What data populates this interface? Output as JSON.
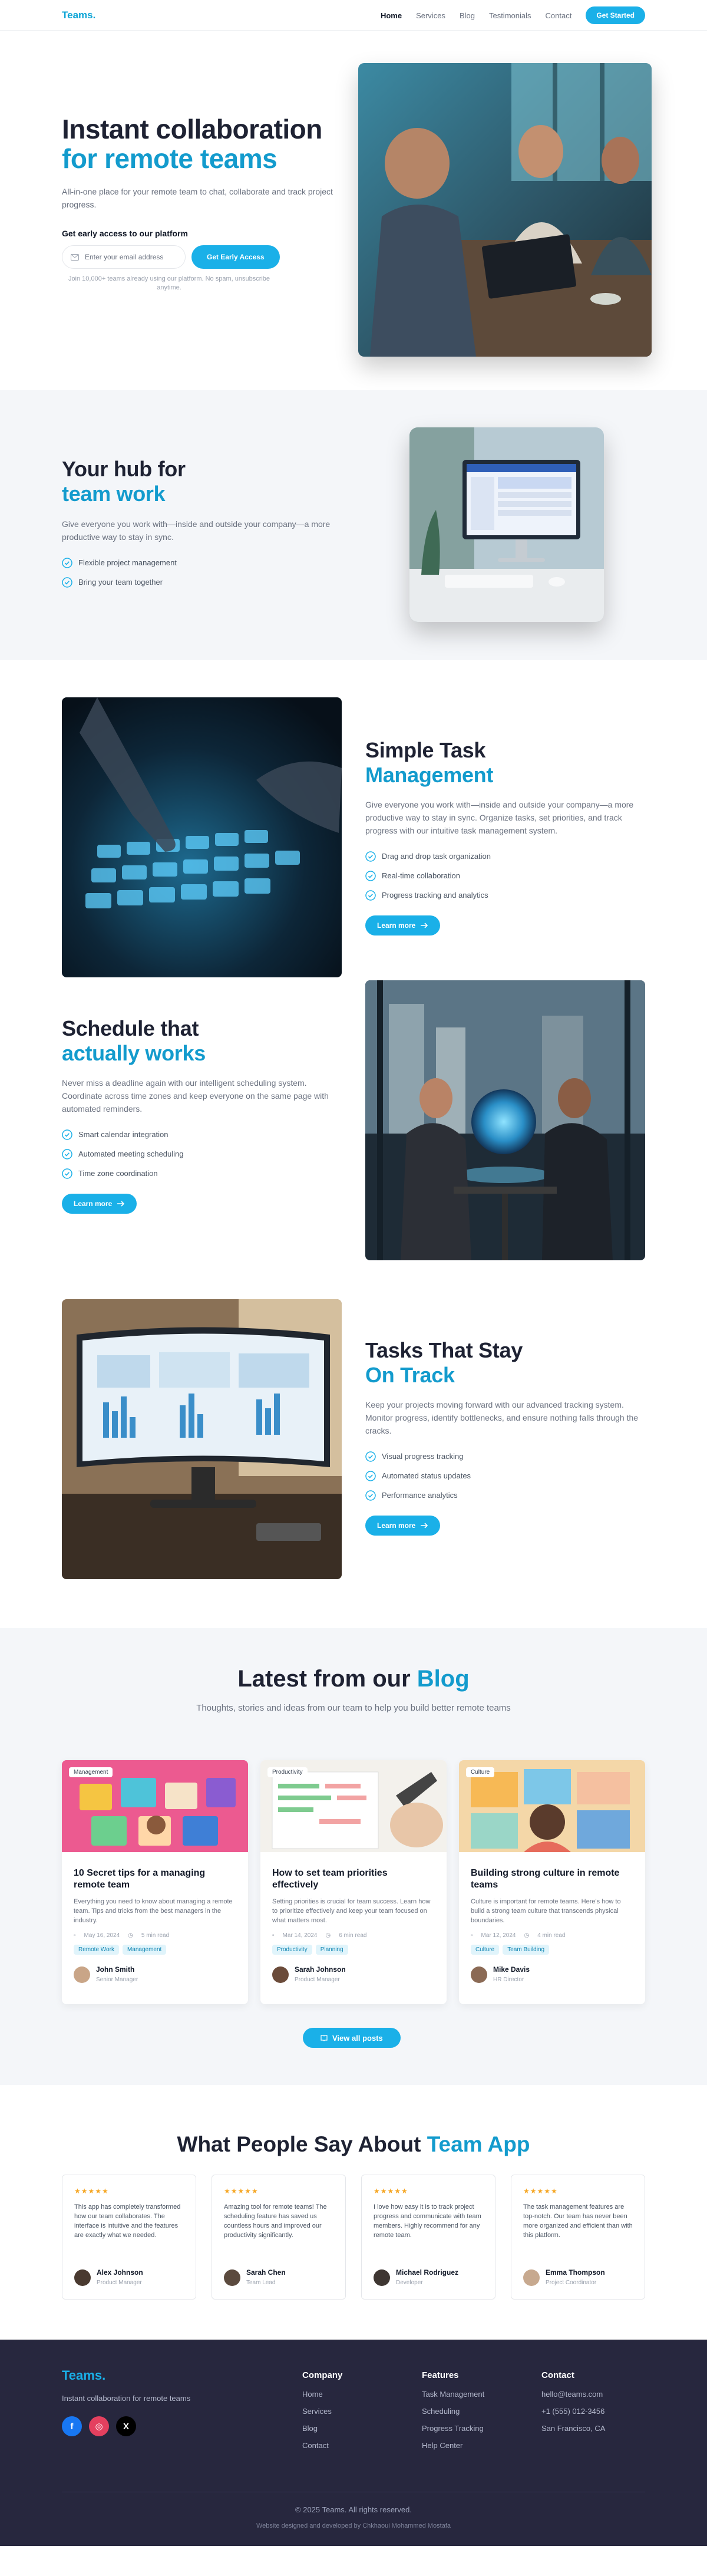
{
  "nav": {
    "logo": "Teams.",
    "links": [
      "Home",
      "Services",
      "Blog",
      "Testimonials",
      "Contact"
    ],
    "cta": "Get Started"
  },
  "hero": {
    "title_line1": "Instant collaboration",
    "title_line2": "for remote teams",
    "subtitle": "All-in-one place for your remote team to chat, collaborate and track project progress.",
    "early_label": "Get early access to our platform",
    "email_placeholder": "Enter your email address",
    "early_button": "Get Early Access",
    "note": "Join 10,000+ teams already using our platform. No spam, unsubscribe anytime."
  },
  "hub": {
    "title_line1": "Your hub for",
    "title_line2": "team work",
    "desc": "Give everyone you work with—inside and outside your company—a more productive way to stay in sync.",
    "features": [
      "Flexible project management",
      "Bring your team together"
    ]
  },
  "task": {
    "title_line1": "Simple Task",
    "title_line2": "Management",
    "desc": "Give everyone you work with—inside and outside your company—a more productive way to stay in sync. Organize tasks, set priorities, and track progress with our intuitive task management system.",
    "features": [
      "Drag and drop task organization",
      "Real-time collaboration",
      "Progress tracking and analytics"
    ],
    "button": "Learn more"
  },
  "schedule": {
    "title_line1": "Schedule that",
    "title_line2": "actually works",
    "desc": "Never miss a deadline again with our intelligent scheduling system. Coordinate across time zones and keep everyone on the same page with automated reminders.",
    "features": [
      "Smart calendar integration",
      "Automated meeting scheduling",
      "Time zone coordination"
    ],
    "button": "Learn more"
  },
  "track": {
    "title_line1": "Tasks That Stay",
    "title_line2": "On Track",
    "desc": "Keep your projects moving forward with our advanced tracking system. Monitor progress, identify bottlenecks, and ensure nothing falls through the cracks.",
    "features": [
      "Visual progress tracking",
      "Automated status updates",
      "Performance analytics"
    ],
    "button": "Learn more"
  },
  "blog": {
    "title_plain": "Latest from our ",
    "title_accent": "Blog",
    "subtitle": "Thoughts, stories and ideas from our team to help you build better remote teams",
    "posts": [
      {
        "badge": "Management",
        "title": "10 Secret tips for a managing remote team",
        "excerpt": "Everything you need to know about managing a remote team. Tips and tricks from the best managers in the industry.",
        "date": "May 16, 2024",
        "read": "5 min read",
        "tags": [
          "Remote Work",
          "Management"
        ],
        "author": "John Smith",
        "role": "Senior Manager"
      },
      {
        "badge": "Productivity",
        "title": "How to set team priorities effectively",
        "excerpt": "Setting priorities is crucial for team success. Learn how to prioritize effectively and keep your team focused on what matters most.",
        "date": "Mar 14, 2024",
        "read": "6 min read",
        "tags": [
          "Productivity",
          "Planning"
        ],
        "author": "Sarah Johnson",
        "role": "Product Manager"
      },
      {
        "badge": "Culture",
        "title": "Building strong culture in remote teams",
        "excerpt": "Culture is important for remote teams. Here's how to build a strong team culture that transcends physical boundaries.",
        "date": "Mar 12, 2024",
        "read": "4 min read",
        "tags": [
          "Culture",
          "Team Building"
        ],
        "author": "Mike Davis",
        "role": "HR Director"
      }
    ],
    "view_all": "View all posts"
  },
  "testimonials": {
    "title_plain": "What People Say About ",
    "title_accent": "Team App",
    "stars": "★★★★★",
    "items": [
      {
        "quote": "This app has completely transformed how our team collaborates. The interface is intuitive and the features are exactly what we needed.",
        "name": "Alex Johnson",
        "role": "Product Manager"
      },
      {
        "quote": "Amazing tool for remote teams! The scheduling feature has saved us countless hours and improved our productivity significantly.",
        "name": "Sarah Chen",
        "role": "Team Lead"
      },
      {
        "quote": "I love how easy it is to track project progress and communicate with team members. Highly recommend for any remote team.",
        "name": "Michael Rodriguez",
        "role": "Developer"
      },
      {
        "quote": "The task management features are top-notch. Our team has never been more organized and efficient than with this platform.",
        "name": "Emma Thompson",
        "role": "Project Coordinator"
      }
    ]
  },
  "footer": {
    "logo": "Teams.",
    "tagline": "Instant collaboration for remote teams",
    "company_heading": "Company",
    "company_links": [
      "Home",
      "Services",
      "Blog",
      "Contact"
    ],
    "features_heading": "Features",
    "features_links": [
      "Task Management",
      "Scheduling",
      "Progress Tracking",
      "Help Center"
    ],
    "contact_heading": "Contact",
    "contact_items": [
      "hello@teams.com",
      "+1 (555) 012-3456",
      "San Francisco, CA"
    ],
    "copyright": "© 2025 Teams. All rights reserved.",
    "credit": "Website designed and developed by Chkhaoui Mohammed Mostafa"
  },
  "colors": {
    "accent": "#1ab0e8",
    "heading": "#1e2233",
    "footer_bg": "#27273e"
  },
  "icons": {
    "check": "check-circle-icon",
    "arrow": "arrow-right-icon",
    "mail": "mail-icon",
    "star": "star-icon"
  }
}
